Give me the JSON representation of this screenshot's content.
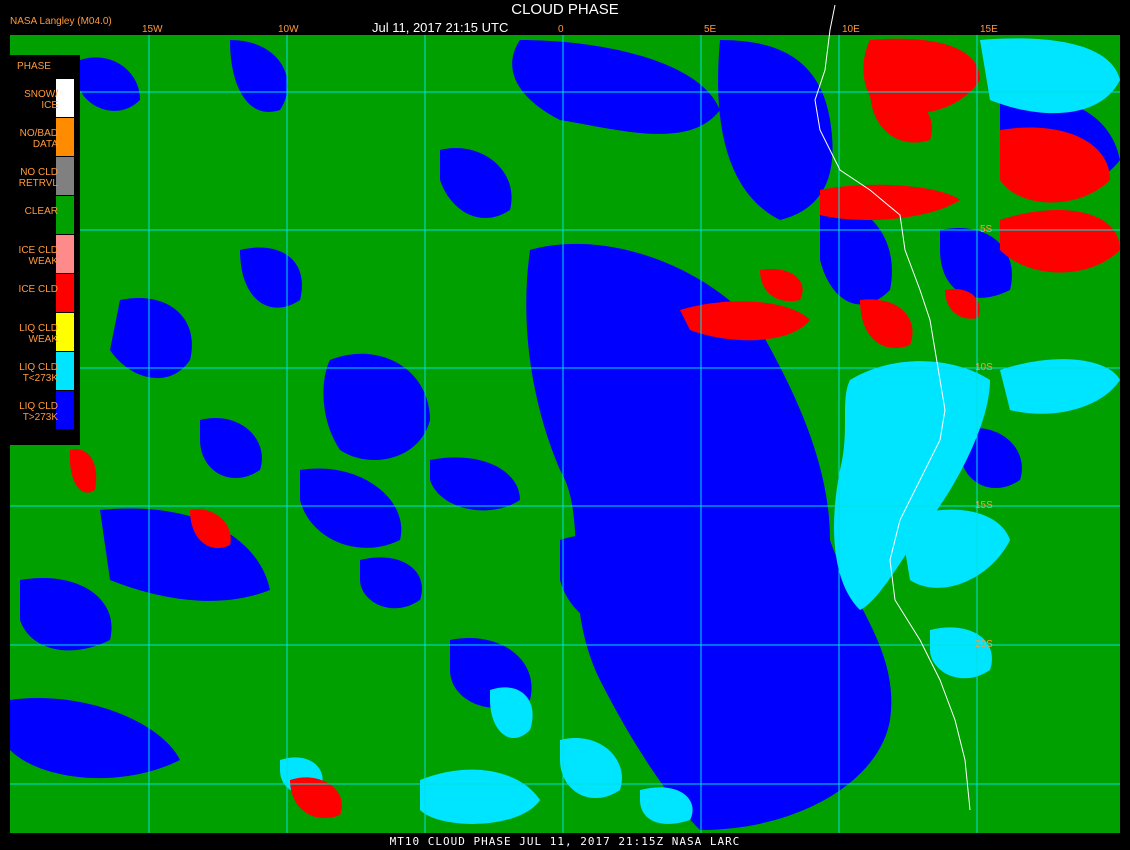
{
  "header": {
    "product_id": "NASA Langley (M04.0)",
    "title": "CLOUD PHASE",
    "datetime": "Jul 11, 2017 21:15 UTC"
  },
  "footer": {
    "caption": "MT10  CLOUD PHASE  JUL 11, 2017 21:15Z  NASA LARC"
  },
  "legend": {
    "title": "PHASE",
    "items": [
      {
        "label": "SNOW/\nICE",
        "color": "#ffffff"
      },
      {
        "label": "NO/BAD\nDATA",
        "color": "#ff8c00"
      },
      {
        "label": "NO CLD\nRETRVL",
        "color": "#808080"
      },
      {
        "label": "CLEAR",
        "color": "#00a000"
      },
      {
        "label": "ICE CLD\nWEAK",
        "color": "#ff8a8a"
      },
      {
        "label": "ICE CLD",
        "color": "#ff0000"
      },
      {
        "label": "LIQ CLD\nWEAK",
        "color": "#ffff00"
      },
      {
        "label": "LIQ CLD\nT<273K",
        "color": "#00e5ff"
      },
      {
        "label": "LIQ CLD\nT>273K",
        "color": "#0000ff"
      }
    ]
  },
  "longitude_labels": [
    "15W",
    "10W",
    "0",
    "5E",
    "10E",
    "15E"
  ],
  "latitude_labels": [
    "5S",
    "10S",
    "15S",
    "20S"
  ],
  "colors": {
    "clear": "#00a000",
    "liquid_warm": "#0000ff",
    "liquid_cold": "#00e5ff",
    "ice": "#ff0000",
    "gridline": "#00e0e0",
    "coastline": "#ffffff"
  }
}
